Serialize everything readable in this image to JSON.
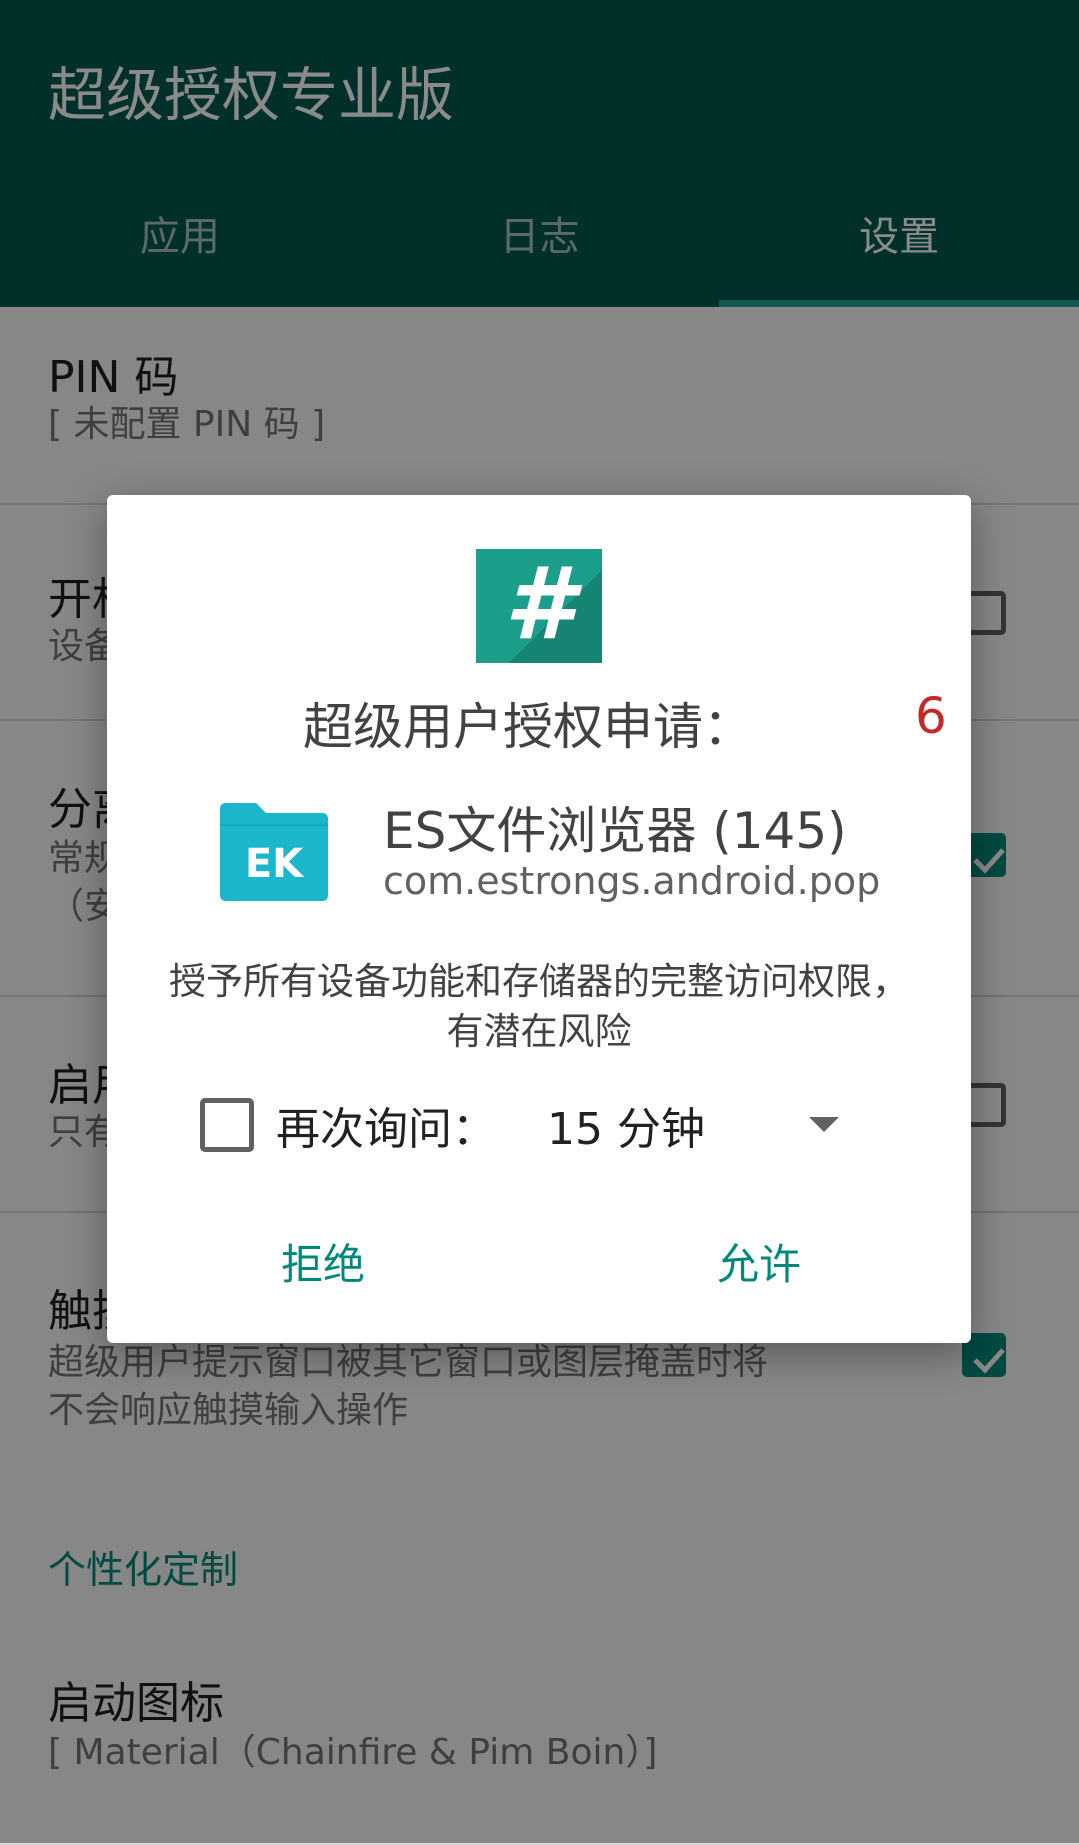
{
  "app": {
    "title": "超级授权专业版",
    "tabs": [
      {
        "label": "应用",
        "active": false
      },
      {
        "label": "日志",
        "active": false
      },
      {
        "label": "设置",
        "active": true
      }
    ]
  },
  "settings": {
    "pin": {
      "title": "PIN 码",
      "summary": "[ 未配置 PIN 码 ]"
    },
    "boot": {
      "title": "开机",
      "summary": "设备",
      "checked": false
    },
    "split": {
      "title": "分离",
      "summary_line1": "常规",
      "summary_line2": "（安",
      "checked": true
    },
    "start": {
      "title": "启用",
      "summary": "只有",
      "checked": false
    },
    "touch": {
      "title": "触摸",
      "summary_line1": "超级用户提示窗口被其它窗口或图层掩盖时将",
      "summary_line2": "不会响应触摸输入操作",
      "checked": true
    },
    "section_personalization": "个性化定制",
    "launcher_icon": {
      "title": "启动图标",
      "summary": "[ Material（Chainfire & Pim Boin）]"
    }
  },
  "dialog": {
    "title": "超级用户授权申请：",
    "countdown": "6",
    "app_name": "ES文件浏览器 (145)",
    "package": "com.estrongs.android.pop",
    "app_icon_text": "EK",
    "warning": "授予所有设备功能和存储器的完整访问权限，有潜在风险",
    "remember_label": "再次询问：",
    "remember_checked": false,
    "duration_selected": "15 分钟",
    "deny_label": "拒绝",
    "allow_label": "允许"
  },
  "colors": {
    "appbar": "#00594c",
    "accent": "#00897b",
    "logo": "#1b9e8a",
    "es_icon": "#1bb5cc",
    "countdown": "#c62828"
  },
  "icons": {
    "su_logo": "hash-icon",
    "app": "es-file-explorer-icon",
    "dropdown": "triangle-down-icon",
    "checkbox_checked": "check-icon"
  }
}
